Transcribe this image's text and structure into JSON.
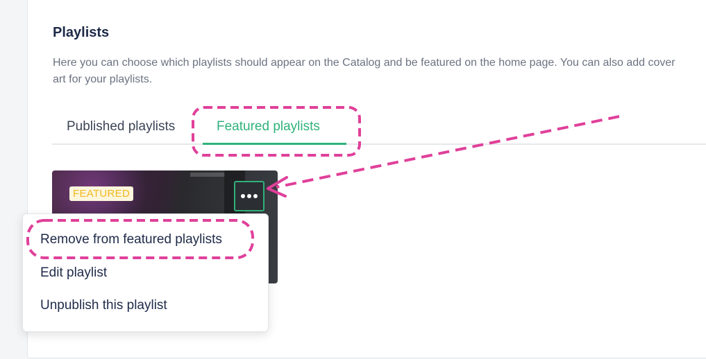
{
  "section": {
    "title": "Playlists",
    "description": "Here you can choose which playlists should appear on the Catalog and be featured on the home page. You can also add cover art for your playlists."
  },
  "tabs": [
    {
      "label": "Published playlists",
      "active": false
    },
    {
      "label": "Featured playlists",
      "active": true
    }
  ],
  "playlist_card": {
    "badge": "FEATURED",
    "more_button_icon": "ellipsis-icon"
  },
  "context_menu": {
    "items": [
      {
        "label": "Remove from featured playlists"
      },
      {
        "label": "Edit playlist"
      },
      {
        "label": "Unpublish this playlist"
      }
    ]
  },
  "colors": {
    "accent": "#2fb27a",
    "badge_text": "#f2b81f",
    "annotation": "#e0409a",
    "heading": "#1e2a48"
  }
}
